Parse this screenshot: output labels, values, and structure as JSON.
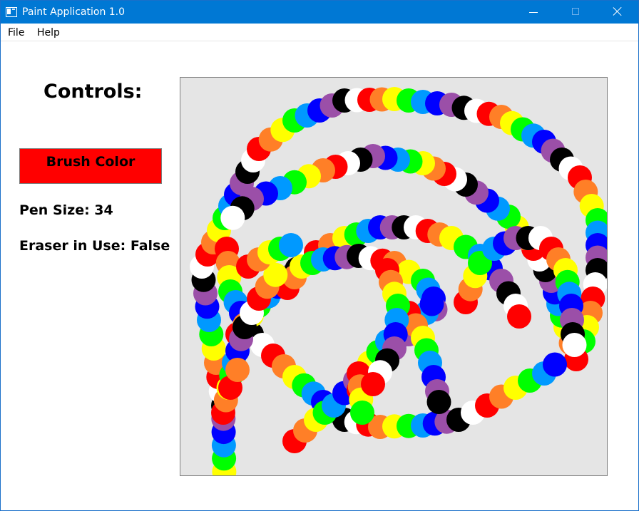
{
  "window": {
    "title": "Paint Application 1.0"
  },
  "menu": {
    "file": "File",
    "help": "Help"
  },
  "controls": {
    "title": "Controls:",
    "brush_color_label": "Brush Color",
    "brush_color": "#ff0000",
    "pen_size_text": "Pen Size: 34",
    "pen_size": 34,
    "eraser_text": "Eraser in Use: False"
  },
  "canvas": {
    "background": "#e5e5e5",
    "stroke_palette": [
      "#ff0000",
      "#ff7f27",
      "#ffff00",
      "#00ff00",
      "#0099ff",
      "#0000ff",
      "#9b4fa8",
      "#000000",
      "#ffffff"
    ]
  }
}
